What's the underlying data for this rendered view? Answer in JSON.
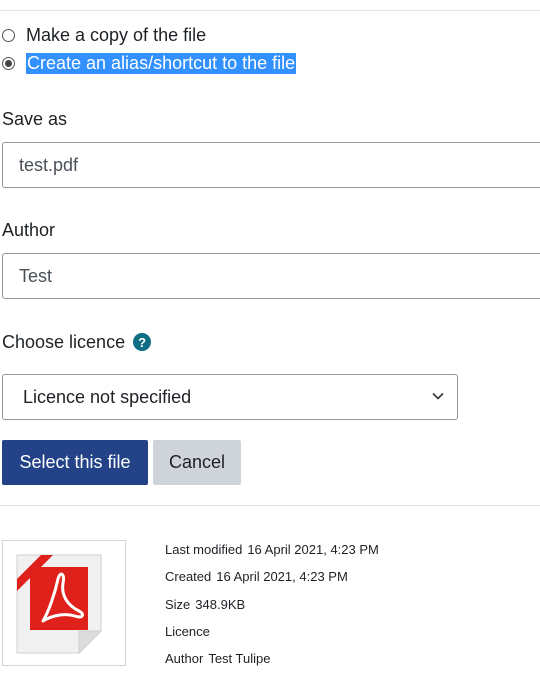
{
  "options": {
    "copy_label": "Make a copy of the file",
    "alias_label": "Create an alias/shortcut to the file"
  },
  "form": {
    "save_as_label": "Save as",
    "save_as_value": "test.pdf",
    "author_label": "Author",
    "author_value": "Test",
    "licence_label": "Choose licence",
    "licence_help_icon": "question-circle-icon",
    "licence_value": "Licence not specified"
  },
  "buttons": {
    "select_label": "Select this file",
    "cancel_label": "Cancel"
  },
  "file_info": {
    "thumbnail_icon": "pdf-file-icon",
    "last_modified_label": "Last modified",
    "last_modified_value": "16 April 2021, 4:23 PM",
    "created_label": "Created",
    "created_value": "16 April 2021, 4:23 PM",
    "size_label": "Size",
    "size_value": "348.9KB",
    "licence_label": "Licence",
    "licence_value": "",
    "author_label": "Author",
    "author_value": "Test Tulipe"
  },
  "colors": {
    "primary_button": "#234287",
    "secondary_button": "#ced4da",
    "selection_highlight": "#3390ff",
    "help_icon": "#0f6e84",
    "pdf_red": "#e0201b"
  }
}
